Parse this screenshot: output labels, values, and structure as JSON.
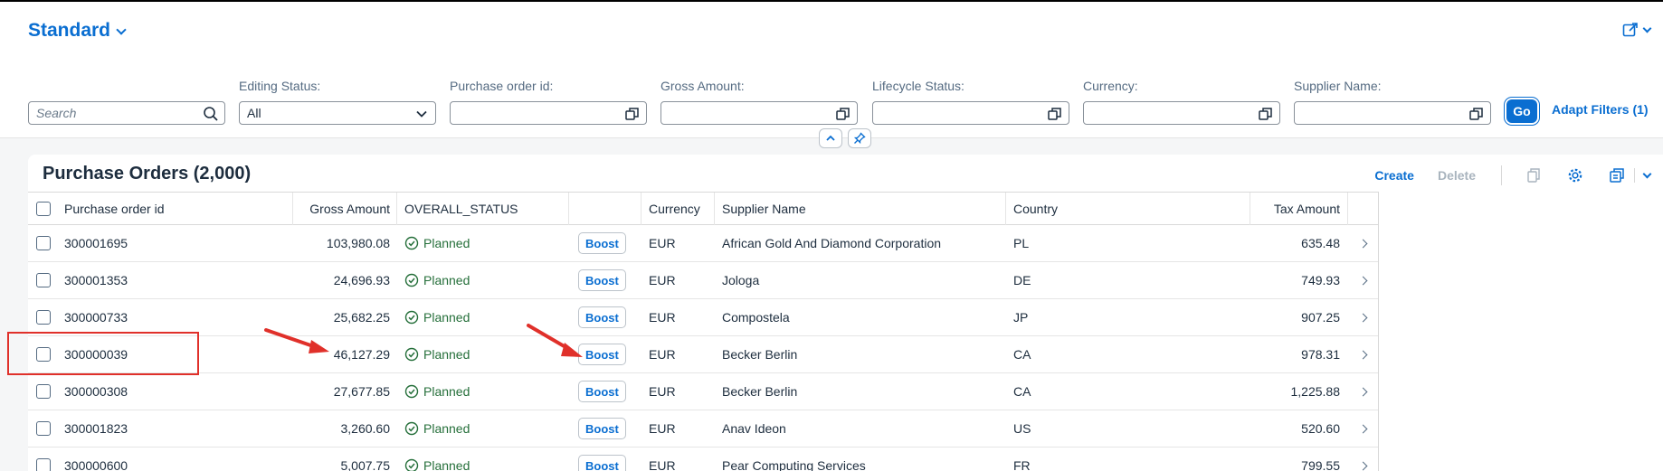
{
  "variant": {
    "title": "Standard"
  },
  "filters": {
    "search": {
      "placeholder": "Search"
    },
    "editing_status": {
      "label": "Editing Status:",
      "value": "All"
    },
    "purchase_order_id": {
      "label": "Purchase order id:"
    },
    "gross_amount": {
      "label": "Gross Amount:"
    },
    "lifecycle_status": {
      "label": "Lifecycle Status:"
    },
    "currency": {
      "label": "Currency:"
    },
    "supplier_name": {
      "label": "Supplier Name:"
    },
    "go_label": "Go",
    "adapt_label": "Adapt Filters (1)"
  },
  "table": {
    "title": "Purchase Orders (2,000)",
    "toolbar": {
      "create": "Create",
      "delete": "Delete"
    },
    "columns": [
      "Purchase order id",
      "Gross Amount",
      "OVERALL_STATUS",
      "",
      "Currency",
      "Supplier Name",
      "Country",
      "Tax Amount"
    ],
    "rows": [
      {
        "id": "300001695",
        "gross": "103,980.08",
        "status": "Planned",
        "action": "Boost",
        "currency": "EUR",
        "supplier": "African Gold And Diamond Corporation",
        "country": "PL",
        "tax": "635.48"
      },
      {
        "id": "300001353",
        "gross": "24,696.93",
        "status": "Planned",
        "action": "Boost",
        "currency": "EUR",
        "supplier": "Jologa",
        "country": "DE",
        "tax": "749.93"
      },
      {
        "id": "300000733",
        "gross": "25,682.25",
        "status": "Planned",
        "action": "Boost",
        "currency": "EUR",
        "supplier": "Compostela",
        "country": "JP",
        "tax": "907.25"
      },
      {
        "id": "300000039",
        "gross": "46,127.29",
        "status": "Planned",
        "action": "Boost",
        "currency": "EUR",
        "supplier": "Becker Berlin",
        "country": "CA",
        "tax": "978.31"
      },
      {
        "id": "300000308",
        "gross": "27,677.85",
        "status": "Planned",
        "action": "Boost",
        "currency": "EUR",
        "supplier": "Becker Berlin",
        "country": "CA",
        "tax": "1,225.88"
      },
      {
        "id": "300001823",
        "gross": "3,260.60",
        "status": "Planned",
        "action": "Boost",
        "currency": "EUR",
        "supplier": "Anav Ideon",
        "country": "US",
        "tax": "520.60"
      },
      {
        "id": "300000600",
        "gross": "5,007.75",
        "status": "Planned",
        "action": "Boost",
        "currency": "EUR",
        "supplier": "Pear Computing Services",
        "country": "FR",
        "tax": "799.55"
      }
    ]
  },
  "colors": {
    "accent": "#0a6ed1",
    "positive": "#256f3a",
    "annotation": "#e0302a"
  },
  "icons": [
    "chevron-down-icon",
    "share-icon",
    "search-icon",
    "value-help-icon",
    "collapse-icon",
    "pin-icon",
    "copy-icon",
    "settings-icon",
    "export-icon",
    "success-icon",
    "nav-arrow-icon"
  ]
}
